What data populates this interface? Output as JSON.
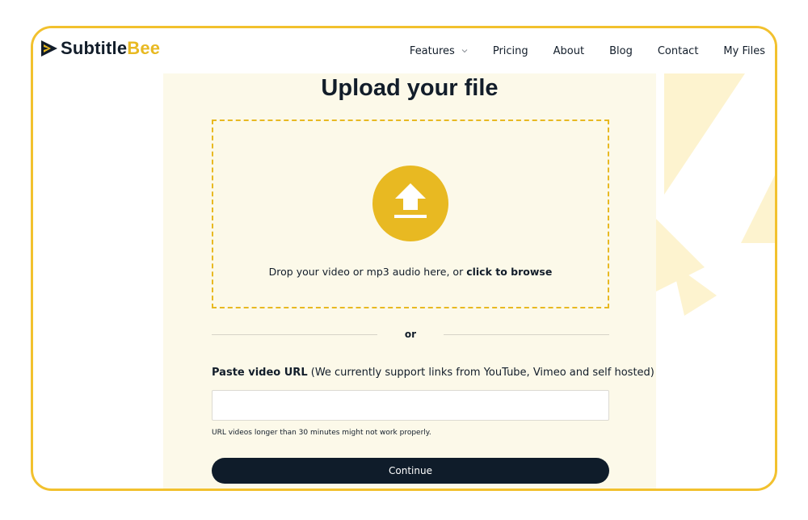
{
  "brand": {
    "name_part1": "Subtitle",
    "name_part2": "Bee",
    "logo_icon": "bee-play-logo-icon",
    "colors": {
      "dark": "#121d2a",
      "accent": "#e8b922",
      "frame": "#f2c12e",
      "panel": "#fcf9e9"
    }
  },
  "nav": {
    "features": "Features",
    "features_icon": "chevron-down-icon",
    "pricing": "Pricing",
    "about": "About",
    "blog": "Blog",
    "contact": "Contact",
    "my_files": "My Files"
  },
  "upload": {
    "title": "Upload your file",
    "icon": "upload-arrow-icon",
    "drop_text": "Drop your video or mp3 audio here, or ",
    "browse_text": "click to browse",
    "or_text": "or"
  },
  "url": {
    "label_bold": "Paste video URL",
    "label_rest": " (We currently support links from YouTube, Vimeo and self hosted)",
    "value": "",
    "placeholder": "",
    "hint": "URL videos longer than 30 minutes might not work properly."
  },
  "actions": {
    "continue": "Continue"
  }
}
